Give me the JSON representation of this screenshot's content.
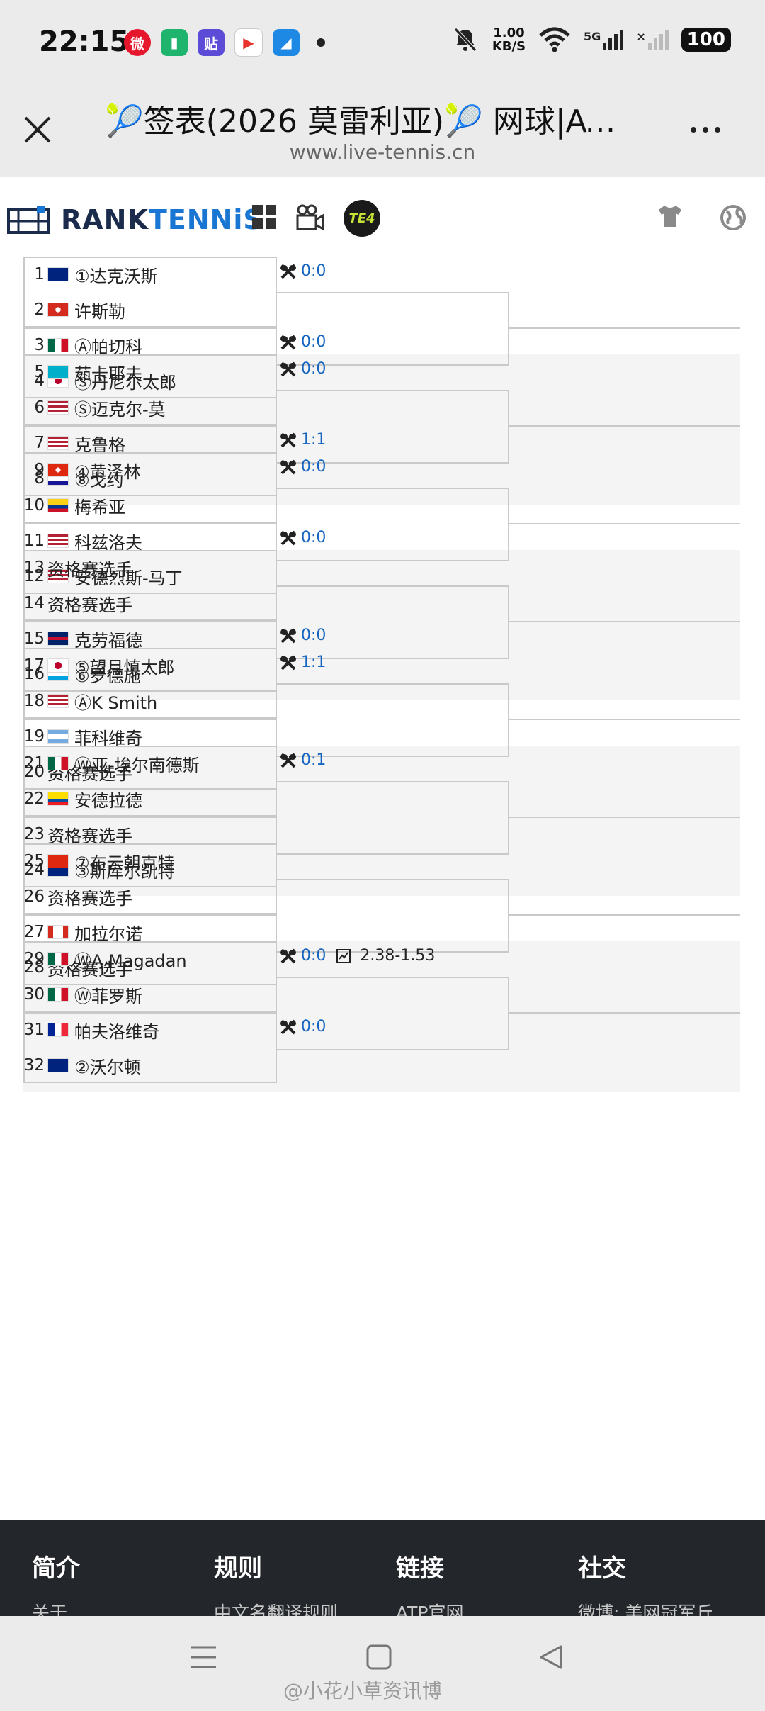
{
  "status": {
    "time": "22:15",
    "speed_value": "1.00",
    "speed_unit": "KB/S",
    "network": "5G",
    "battery": "100"
  },
  "header": {
    "title": "🎾签表(2026 莫雷利亚)🎾 网球|ATP...",
    "url": "www.live-tennis.cn"
  },
  "brand": {
    "name_a": "RANK",
    "name_b": "TENNiS",
    "te4_label": "TE4"
  },
  "draw": {
    "players": [
      {
        "num": "1",
        "flag": "au",
        "name": "①达克沃斯"
      },
      {
        "num": "2",
        "flag": "ch",
        "name": "许斯勒"
      },
      {
        "num": "3",
        "flag": "mx",
        "name": "Ⓐ帕切科"
      },
      {
        "num": "4",
        "flag": "jp",
        "name": "Ⓢ丹尼尔太郎"
      },
      {
        "num": "5",
        "flag": "kz",
        "name": "茹卡耶夫"
      },
      {
        "num": "6",
        "flag": "us",
        "name": "Ⓢ迈克尔-莫"
      },
      {
        "num": "7",
        "flag": "us",
        "name": "克鲁格"
      },
      {
        "num": "8",
        "flag": "hr",
        "name": "⑧戈约"
      },
      {
        "num": "9",
        "flag": "hk",
        "name": "④黄泽林"
      },
      {
        "num": "10",
        "flag": "co",
        "name": "梅希亚"
      },
      {
        "num": "11",
        "flag": "us",
        "name": "科兹洛夫"
      },
      {
        "num": "12",
        "flag": "us",
        "name": "安德烈斯-马丁"
      },
      {
        "num": "13",
        "flag": "",
        "name": "资格赛选手"
      },
      {
        "num": "14",
        "flag": "",
        "name": "资格赛选手"
      },
      {
        "num": "15",
        "flag": "gb",
        "name": "克劳福德"
      },
      {
        "num": "16",
        "flag": "lu",
        "name": "⑥罗德施"
      },
      {
        "num": "17",
        "flag": "jp",
        "name": "⑤望月慎太郎"
      },
      {
        "num": "18",
        "flag": "us",
        "name": "ⒶK Smith"
      },
      {
        "num": "19",
        "flag": "ar",
        "name": "菲科维奇"
      },
      {
        "num": "20",
        "flag": "",
        "name": "资格赛选手"
      },
      {
        "num": "21",
        "flag": "mx",
        "name": "Ⓦ亚-埃尔南德斯"
      },
      {
        "num": "22",
        "flag": "ec",
        "name": "安德拉德"
      },
      {
        "num": "23",
        "flag": "",
        "name": "资格赛选手"
      },
      {
        "num": "24",
        "flag": "au",
        "name": "③斯库尔凯特"
      },
      {
        "num": "25",
        "flag": "cn",
        "name": "⑦布云朝克特"
      },
      {
        "num": "26",
        "flag": "",
        "name": "资格赛选手"
      },
      {
        "num": "27",
        "flag": "ca",
        "name": "加拉尔诺"
      },
      {
        "num": "28",
        "flag": "",
        "name": "资格赛选手"
      },
      {
        "num": "29",
        "flag": "mx",
        "name": "ⓌA Magadan"
      },
      {
        "num": "30",
        "flag": "mx",
        "name": "Ⓦ菲罗斯"
      },
      {
        "num": "31",
        "flag": "fr",
        "name": "帕夫洛维奇"
      },
      {
        "num": "32",
        "flag": "au",
        "name": "②沃尔顿"
      }
    ],
    "matches": [
      {
        "score": "0:0",
        "odds": ""
      },
      {
        "score": "0:0",
        "odds": ""
      },
      {
        "score": "0:0",
        "odds": ""
      },
      {
        "score": "1:1",
        "odds": ""
      },
      {
        "score": "0:0",
        "odds": ""
      },
      {
        "score": "0:0",
        "odds": ""
      },
      {
        "score": "",
        "odds": ""
      },
      {
        "score": "0:0",
        "odds": ""
      },
      {
        "score": "1:1",
        "odds": ""
      },
      {
        "score": "",
        "odds": ""
      },
      {
        "score": "0:1",
        "odds": ""
      },
      {
        "score": "",
        "odds": ""
      },
      {
        "score": "",
        "odds": ""
      },
      {
        "score": "",
        "odds": ""
      },
      {
        "score": "0:0",
        "odds": "2.38-1.53"
      },
      {
        "score": "0:0",
        "odds": ""
      }
    ]
  },
  "footer": {
    "cols": [
      {
        "head": "简介",
        "link": "关于"
      },
      {
        "head": "规则",
        "link": "中文名翻译规则"
      },
      {
        "head": "链接",
        "link": "ATP官网"
      },
      {
        "head": "社交",
        "link": "微博: 美网冠军丘"
      }
    ]
  },
  "watermark": "@小花小草资讯博",
  "colors": {
    "accent": "#1976d2",
    "score": "#1565c0",
    "footer_bg": "#23262b",
    "te4_green": "#c6e236"
  }
}
